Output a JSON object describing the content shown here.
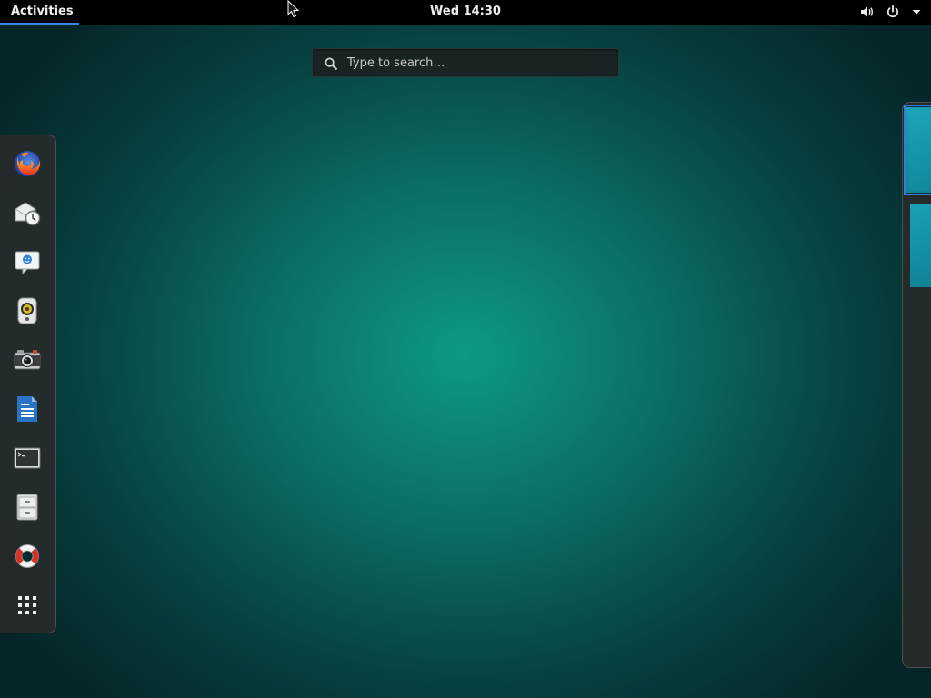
{
  "topbar": {
    "activities_label": "Activities",
    "clock": "Wed 14:30",
    "system_icons": [
      "volume-icon",
      "power-icon",
      "dropdown-arrow-icon"
    ]
  },
  "search": {
    "placeholder": "Type to search…",
    "value": ""
  },
  "dash": {
    "items": [
      {
        "name": "firefox",
        "icon": "firefox-icon"
      },
      {
        "name": "evolution",
        "icon": "mail-clock-icon"
      },
      {
        "name": "empathy",
        "icon": "chat-icon"
      },
      {
        "name": "rhythmbox",
        "icon": "speaker-icon"
      },
      {
        "name": "cheese",
        "icon": "camera-icon"
      },
      {
        "name": "libreoffice-writer",
        "icon": "document-icon"
      },
      {
        "name": "terminal",
        "icon": "terminal-icon"
      },
      {
        "name": "files",
        "icon": "file-cabinet-icon"
      },
      {
        "name": "help",
        "icon": "lifebuoy-icon"
      },
      {
        "name": "show-applications",
        "icon": "grid-icon"
      }
    ]
  },
  "workspaces": {
    "count": 2,
    "active_index": 0
  },
  "colors": {
    "topbar_bg": "#000000",
    "accent": "#3584e4",
    "desktop_center": "#0e9a84",
    "desktop_edge": "#052528"
  }
}
